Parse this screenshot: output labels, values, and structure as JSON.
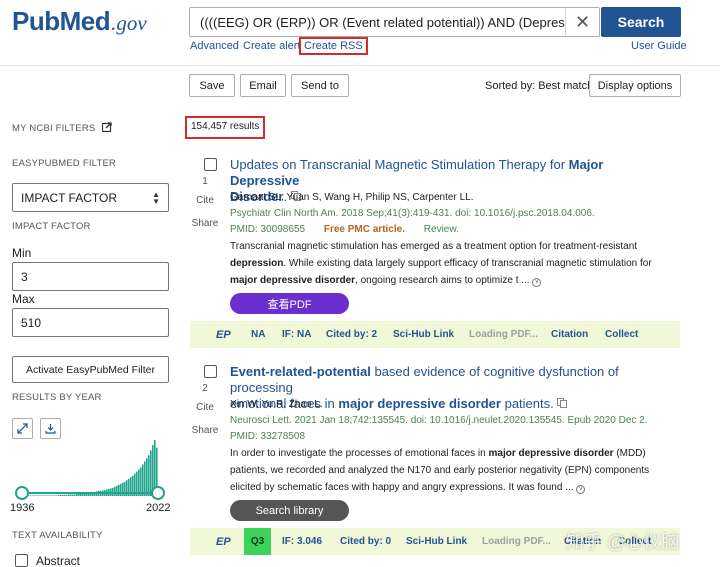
{
  "header": {
    "logo_pub": "Pub",
    "logo_med": "Med",
    "logo_gov": ".gov",
    "search_value": "((((EEG) OR (ERP)) OR (Event related potential)) AND (Depression)) OR (m",
    "search_button": "Search",
    "advanced": "Advanced",
    "create_alert": "Create alert",
    "create_rss": "Create RSS",
    "user_guide": "User Guide"
  },
  "toolbar": {
    "save": "Save",
    "email": "Email",
    "send_to": "Send to",
    "sorted_by": "Sorted by: Best match",
    "display_options": "Display options"
  },
  "sidebar": {
    "my_ncbi_filters": "MY NCBI FILTERS",
    "easypubmed_filter": "EASYPUBMED FILTER",
    "select_value": "IMPACT FACTOR",
    "impact_factor_label": "IMPACT FACTOR",
    "min_label": "Min",
    "min_value": "3",
    "max_label": "Max",
    "max_value": "510",
    "activate_button": "Activate EasyPubMed Filter",
    "results_by_year": "RESULTS BY YEAR",
    "year_start": "1936",
    "year_end": "2022",
    "text_availability": "TEXT AVAILABILITY",
    "abstract": "Abstract",
    "histogram_values": [
      1,
      1,
      1,
      1,
      1,
      1,
      1,
      1,
      1,
      1,
      1,
      1,
      1,
      1,
      1,
      1,
      1,
      1,
      2,
      2,
      2,
      2,
      2,
      3,
      3,
      3,
      3,
      4,
      4,
      4,
      5,
      5,
      6,
      6,
      7,
      7,
      8,
      9,
      10,
      10,
      11,
      12,
      13,
      14,
      15,
      16,
      18,
      20,
      22,
      24,
      26,
      28,
      31,
      34,
      37,
      40,
      44,
      48,
      52,
      56,
      62,
      68,
      74,
      80,
      90,
      100,
      110,
      95
    ]
  },
  "results": {
    "count": "154,457 results",
    "articles": [
      {
        "number": "1",
        "cite": "Cite",
        "share": "Share",
        "title_a": "Updates on Transcranial Magnetic Stimulation Therapy for ",
        "title_b": "Major Depressive",
        "title_c": "Disorder",
        "title_d": ".",
        "authors": "Garnaat SL, Yuan S, Wang H, Philip NS, Carpenter LL.",
        "citation": "Psychiatr Clin North Am. 2018 Sep;41(3):419-431. doi: 10.1016/j.psc.2018.04.006.",
        "pmid": "PMID: 30098655",
        "free_pmc": "Free PMC article.",
        "review": "Review.",
        "abs1": "Transcranial magnetic stimulation has emerged as a treatment option for treatment-resistant",
        "abs2_b": "depression",
        "abs2": ". While existing data largely support efficacy of transcranial magnetic stimulation for",
        "abs3_b": "major depressive disorder",
        "abs3": ", ongoing research aims to optimize t ...",
        "button": "查看PDF",
        "ep": "EP",
        "ep_quartile": "NA",
        "if": "IF: NA",
        "cited": "Cited by: 2",
        "scihub": "Sci-Hub Link",
        "loading": "Loading PDF...",
        "citation_link": "Citation",
        "collect": "Collect"
      },
      {
        "number": "2",
        "cite": "Cite",
        "share": "Share",
        "title_a": "Event-related-potential",
        "title_b": " based evidence of cognitive dysfunction of processing",
        "title_c": "emotional faces in ",
        "title_d": "major depressive disorder",
        "title_e": " patients.",
        "authors": "Xin W, Yu R, Zhao L.",
        "citation": "Neurosci Lett. 2021 Jan 18;742:135545. doi: 10.1016/j.neulet.2020.135545. Epub 2020 Dec 2.",
        "pmid": "PMID: 33278508",
        "abs1_a": "In order to investigate the processes of emotional faces in ",
        "abs1_b": "major depressive disorder",
        "abs1_c": " (MDD)",
        "abs2": "patients, we recorded and analyzed the N170 and early posterior negativity (EPN) components",
        "abs3": "elicited by schematic faces with happy and angry expressions. It was found ...",
        "button": "Search library",
        "ep": "EP",
        "ep_quartile": "Q3",
        "if": "IF: 3.046",
        "cited": "Cited by: 0",
        "scihub": "Sci-Hub Link",
        "loading": "Loading PDF...",
        "citation_link": "Citation",
        "collect": "Collect"
      }
    ]
  },
  "watermark": "知乎 @心仪脑",
  "colors": {
    "brand": "#205493",
    "highlight_box": "#d62b2b",
    "slider": "#20a58c",
    "pdf_button": "#6b2fd0",
    "ep_bar": "#f1f8d8",
    "q3_badge": "#3dd35a"
  }
}
